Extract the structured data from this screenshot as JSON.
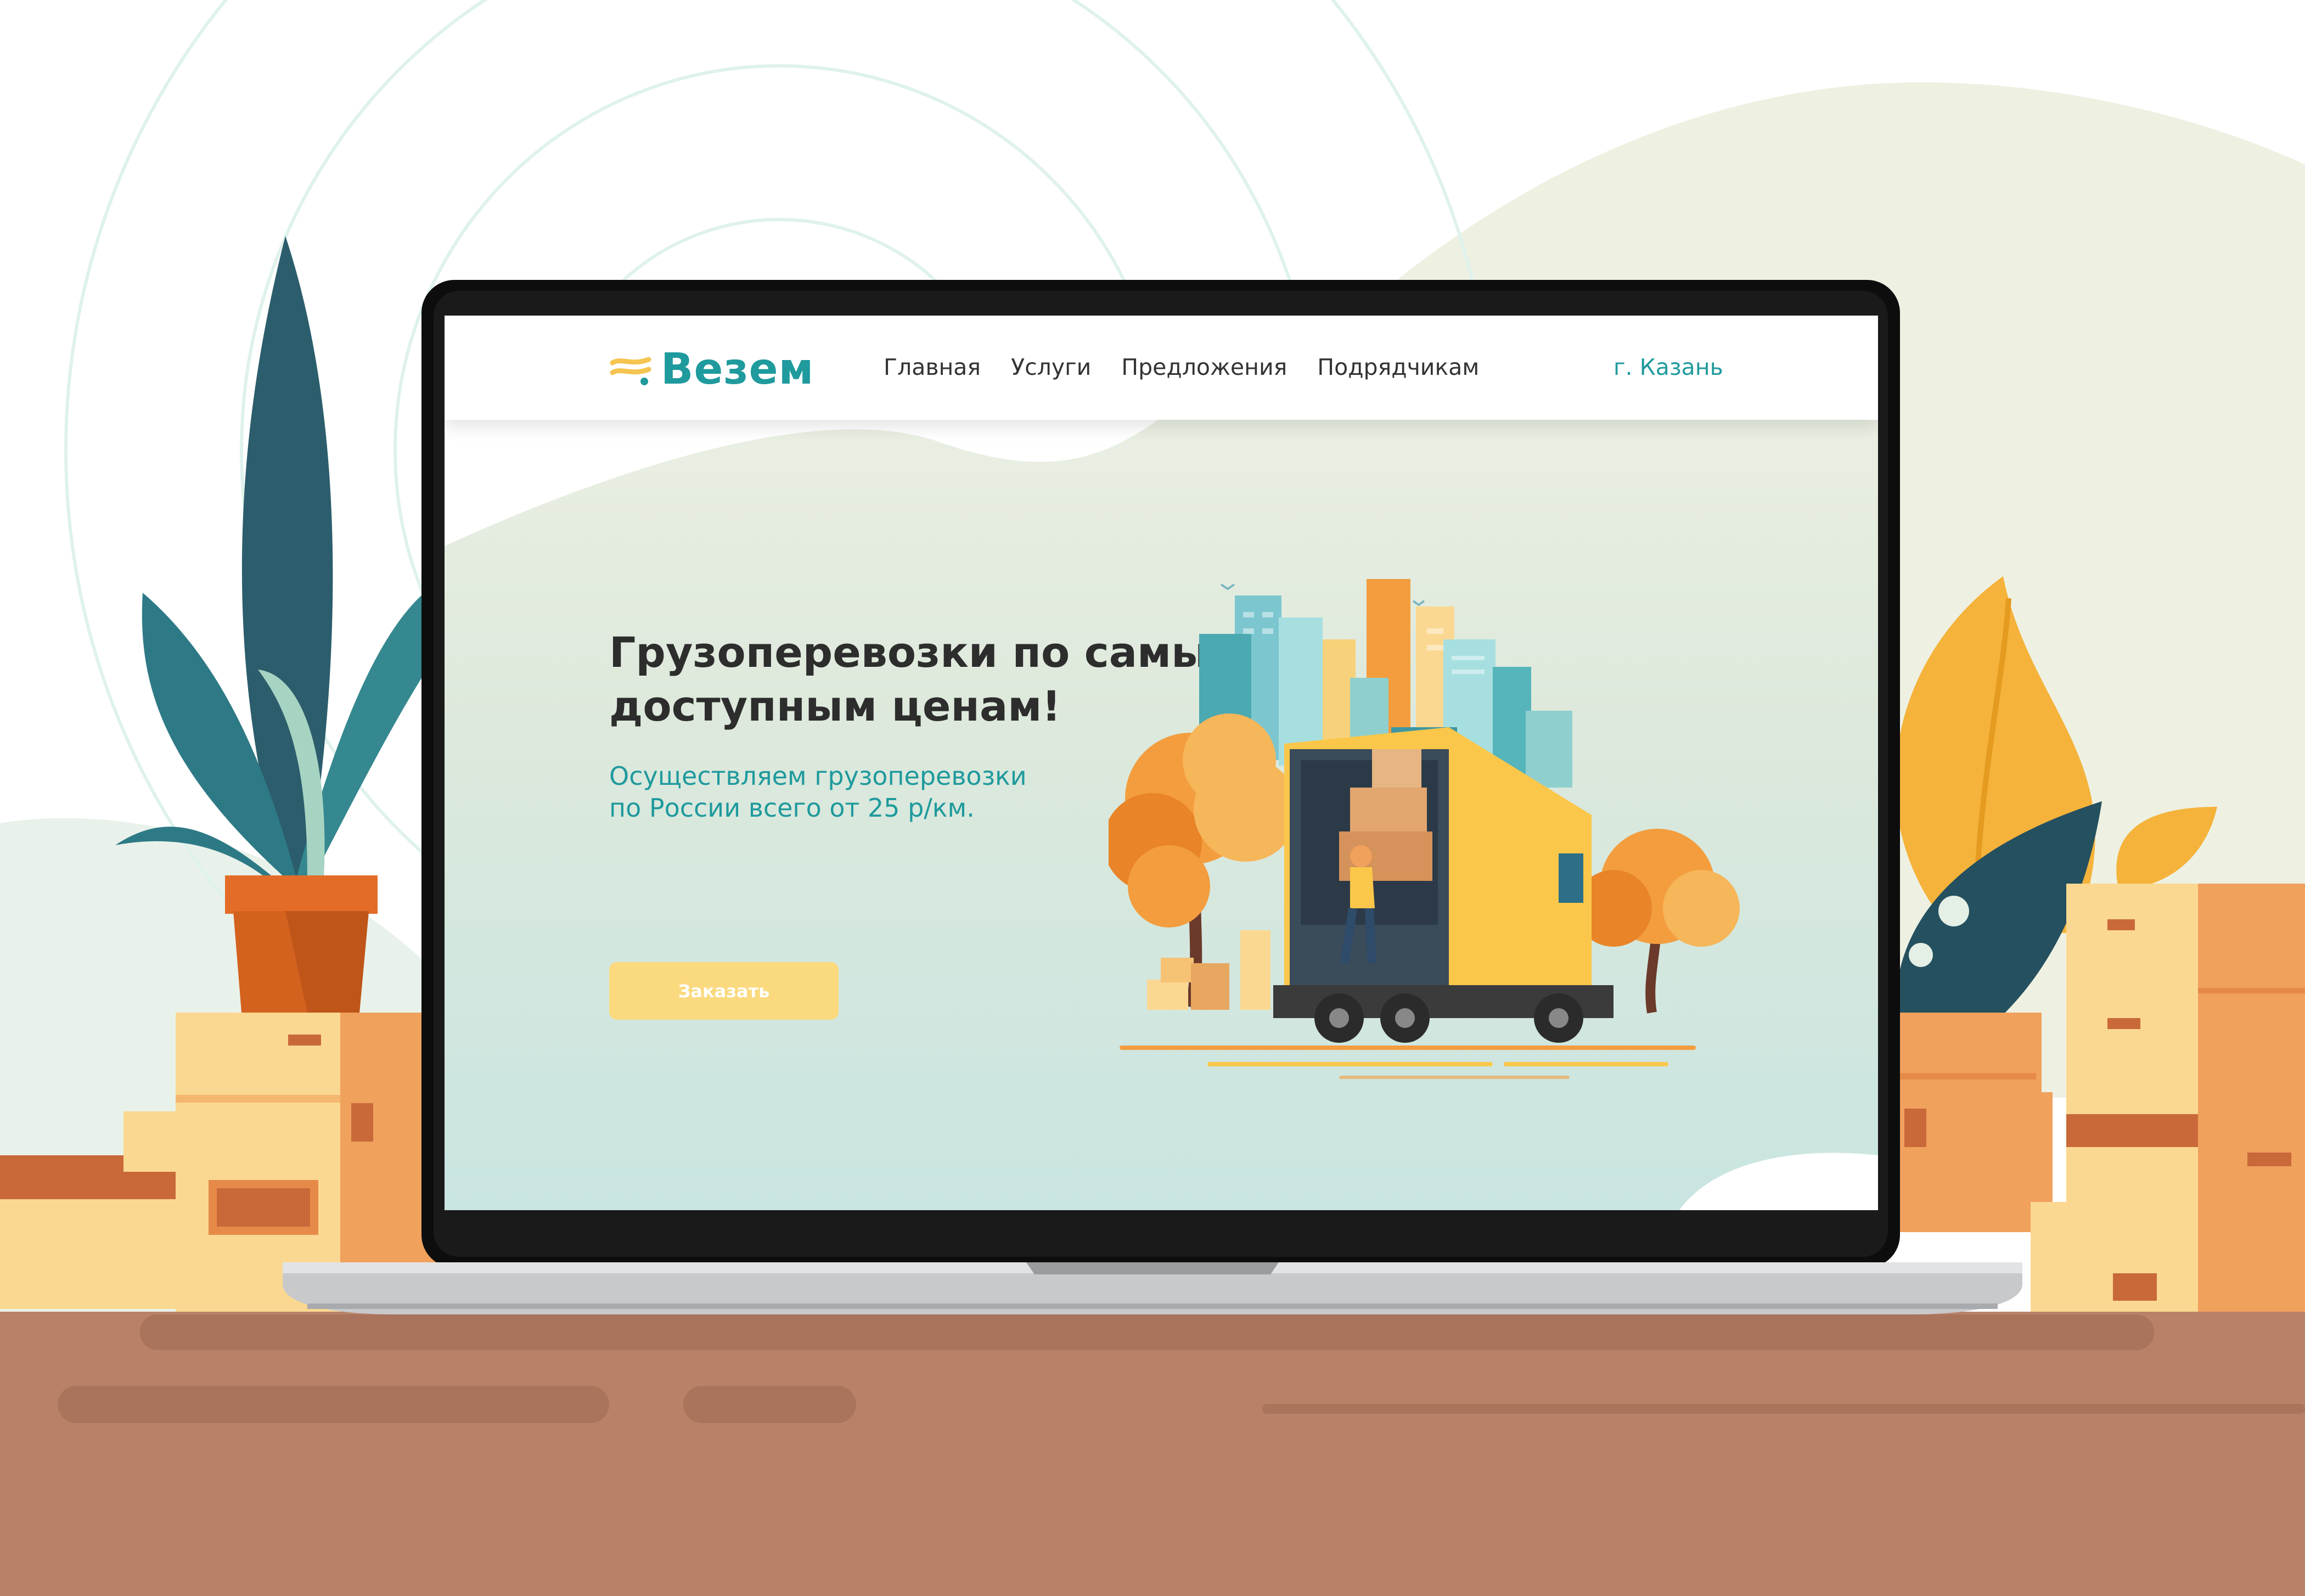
{
  "site": {
    "logo_text": "Везем",
    "nav": [
      "Главная",
      "Услуги",
      "Предложения",
      "Подрядчикам"
    ],
    "city": "г. Казань"
  },
  "hero": {
    "title_line1": "Грузоперевозки по самым",
    "title_line2": "доступным ценам!",
    "subtitle_line1": "Осуществляем грузоперевозки",
    "subtitle_line2": "по России всего от 25 р/км.",
    "button_label": "Заказать"
  },
  "colors": {
    "brand_teal": "#1f9a9d",
    "accent_yellow": "#fbd97e",
    "desk": "#b98268",
    "box": "#fbd891",
    "box_dark": "#f0a15c"
  },
  "icons": [
    "logo-waves-icon"
  ]
}
